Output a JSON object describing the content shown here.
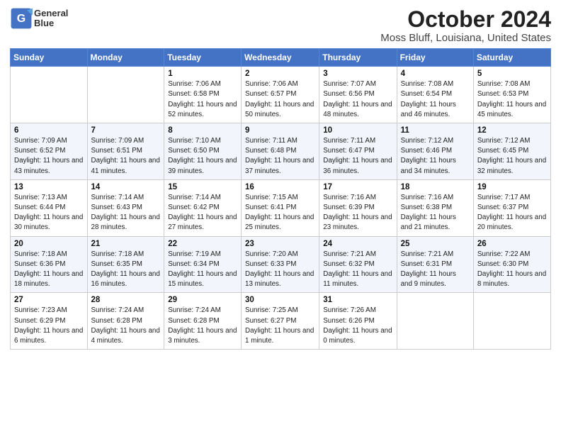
{
  "logo": {
    "line1": "General",
    "line2": "Blue"
  },
  "title": "October 2024",
  "subtitle": "Moss Bluff, Louisiana, United States",
  "days_header": [
    "Sunday",
    "Monday",
    "Tuesday",
    "Wednesday",
    "Thursday",
    "Friday",
    "Saturday"
  ],
  "weeks": [
    [
      {
        "num": "",
        "detail": ""
      },
      {
        "num": "",
        "detail": ""
      },
      {
        "num": "1",
        "detail": "Sunrise: 7:06 AM\nSunset: 6:58 PM\nDaylight: 11 hours and 52 minutes."
      },
      {
        "num": "2",
        "detail": "Sunrise: 7:06 AM\nSunset: 6:57 PM\nDaylight: 11 hours and 50 minutes."
      },
      {
        "num": "3",
        "detail": "Sunrise: 7:07 AM\nSunset: 6:56 PM\nDaylight: 11 hours and 48 minutes."
      },
      {
        "num": "4",
        "detail": "Sunrise: 7:08 AM\nSunset: 6:54 PM\nDaylight: 11 hours and 46 minutes."
      },
      {
        "num": "5",
        "detail": "Sunrise: 7:08 AM\nSunset: 6:53 PM\nDaylight: 11 hours and 45 minutes."
      }
    ],
    [
      {
        "num": "6",
        "detail": "Sunrise: 7:09 AM\nSunset: 6:52 PM\nDaylight: 11 hours and 43 minutes."
      },
      {
        "num": "7",
        "detail": "Sunrise: 7:09 AM\nSunset: 6:51 PM\nDaylight: 11 hours and 41 minutes."
      },
      {
        "num": "8",
        "detail": "Sunrise: 7:10 AM\nSunset: 6:50 PM\nDaylight: 11 hours and 39 minutes."
      },
      {
        "num": "9",
        "detail": "Sunrise: 7:11 AM\nSunset: 6:48 PM\nDaylight: 11 hours and 37 minutes."
      },
      {
        "num": "10",
        "detail": "Sunrise: 7:11 AM\nSunset: 6:47 PM\nDaylight: 11 hours and 36 minutes."
      },
      {
        "num": "11",
        "detail": "Sunrise: 7:12 AM\nSunset: 6:46 PM\nDaylight: 11 hours and 34 minutes."
      },
      {
        "num": "12",
        "detail": "Sunrise: 7:12 AM\nSunset: 6:45 PM\nDaylight: 11 hours and 32 minutes."
      }
    ],
    [
      {
        "num": "13",
        "detail": "Sunrise: 7:13 AM\nSunset: 6:44 PM\nDaylight: 11 hours and 30 minutes."
      },
      {
        "num": "14",
        "detail": "Sunrise: 7:14 AM\nSunset: 6:43 PM\nDaylight: 11 hours and 28 minutes."
      },
      {
        "num": "15",
        "detail": "Sunrise: 7:14 AM\nSunset: 6:42 PM\nDaylight: 11 hours and 27 minutes."
      },
      {
        "num": "16",
        "detail": "Sunrise: 7:15 AM\nSunset: 6:41 PM\nDaylight: 11 hours and 25 minutes."
      },
      {
        "num": "17",
        "detail": "Sunrise: 7:16 AM\nSunset: 6:39 PM\nDaylight: 11 hours and 23 minutes."
      },
      {
        "num": "18",
        "detail": "Sunrise: 7:16 AM\nSunset: 6:38 PM\nDaylight: 11 hours and 21 minutes."
      },
      {
        "num": "19",
        "detail": "Sunrise: 7:17 AM\nSunset: 6:37 PM\nDaylight: 11 hours and 20 minutes."
      }
    ],
    [
      {
        "num": "20",
        "detail": "Sunrise: 7:18 AM\nSunset: 6:36 PM\nDaylight: 11 hours and 18 minutes."
      },
      {
        "num": "21",
        "detail": "Sunrise: 7:18 AM\nSunset: 6:35 PM\nDaylight: 11 hours and 16 minutes."
      },
      {
        "num": "22",
        "detail": "Sunrise: 7:19 AM\nSunset: 6:34 PM\nDaylight: 11 hours and 15 minutes."
      },
      {
        "num": "23",
        "detail": "Sunrise: 7:20 AM\nSunset: 6:33 PM\nDaylight: 11 hours and 13 minutes."
      },
      {
        "num": "24",
        "detail": "Sunrise: 7:21 AM\nSunset: 6:32 PM\nDaylight: 11 hours and 11 minutes."
      },
      {
        "num": "25",
        "detail": "Sunrise: 7:21 AM\nSunset: 6:31 PM\nDaylight: 11 hours and 9 minutes."
      },
      {
        "num": "26",
        "detail": "Sunrise: 7:22 AM\nSunset: 6:30 PM\nDaylight: 11 hours and 8 minutes."
      }
    ],
    [
      {
        "num": "27",
        "detail": "Sunrise: 7:23 AM\nSunset: 6:29 PM\nDaylight: 11 hours and 6 minutes."
      },
      {
        "num": "28",
        "detail": "Sunrise: 7:24 AM\nSunset: 6:28 PM\nDaylight: 11 hours and 4 minutes."
      },
      {
        "num": "29",
        "detail": "Sunrise: 7:24 AM\nSunset: 6:28 PM\nDaylight: 11 hours and 3 minutes."
      },
      {
        "num": "30",
        "detail": "Sunrise: 7:25 AM\nSunset: 6:27 PM\nDaylight: 11 hours and 1 minute."
      },
      {
        "num": "31",
        "detail": "Sunrise: 7:26 AM\nSunset: 6:26 PM\nDaylight: 11 hours and 0 minutes."
      },
      {
        "num": "",
        "detail": ""
      },
      {
        "num": "",
        "detail": ""
      }
    ]
  ]
}
